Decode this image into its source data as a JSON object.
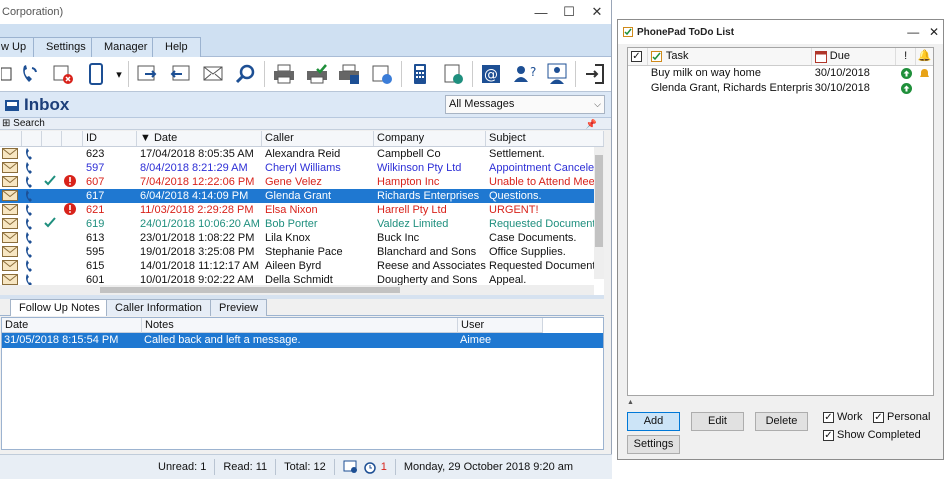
{
  "main_window": {
    "title": "Corporation)",
    "menu_tabs": [
      "w Up",
      "Settings",
      "Manager",
      "Help"
    ],
    "inbox_title": "Inbox",
    "filter_value": "All Messages",
    "search_label": "Search",
    "columns": [
      "ID",
      "Date",
      "Caller",
      "Company",
      "Subject"
    ],
    "messages": [
      {
        "id": "623",
        "date": "17/04/2018 8:05:35 AM",
        "caller": "Alexandra Reid",
        "company": "Campbell Co",
        "subject": "Settlement.",
        "style": "normal",
        "done": false,
        "urgent": false
      },
      {
        "id": "597",
        "date": "8/04/2018 8:21:29 AM",
        "caller": "Cheryl Williams",
        "company": "Wilkinson Pty Ltd",
        "subject": "Appointment Cancele",
        "style": "blue",
        "done": false,
        "urgent": false
      },
      {
        "id": "607",
        "date": "7/04/2018 12:22:06 PM",
        "caller": "Gene Velez",
        "company": "Hampton Inc",
        "subject": "Unable to Attend Mee",
        "style": "red",
        "done": true,
        "urgent": true
      },
      {
        "id": "617",
        "date": "6/04/2018 4:14:09 PM",
        "caller": "Glenda Grant",
        "company": "Richards Enterprises",
        "subject": "Questions.",
        "style": "selected",
        "done": false,
        "urgent": false
      },
      {
        "id": "621",
        "date": "11/03/2018 2:29:28 PM",
        "caller": "Elsa Nixon",
        "company": "Harrell Pty Ltd",
        "subject": "URGENT!",
        "style": "red",
        "done": false,
        "urgent": true
      },
      {
        "id": "619",
        "date": "24/01/2018 10:06:20 AM",
        "caller": "Bob Porter",
        "company": "Valdez Limited",
        "subject": "Requested Document",
        "style": "teal",
        "done": true,
        "urgent": false
      },
      {
        "id": "613",
        "date": "23/01/2018 1:08:22 PM",
        "caller": "Lila Knox",
        "company": "Buck Inc",
        "subject": "Case Documents.",
        "style": "normal",
        "done": false,
        "urgent": false
      },
      {
        "id": "595",
        "date": "19/01/2018 3:25:08 PM",
        "caller": "Stephanie Pace",
        "company": "Blanchard and Sons",
        "subject": "Office Supplies.",
        "style": "normal",
        "done": false,
        "urgent": false
      },
      {
        "id": "615",
        "date": "14/01/2018 11:12:17 AM",
        "caller": "Aileen Byrd",
        "company": "Reese and Associates",
        "subject": "Requested Document",
        "style": "normal",
        "done": false,
        "urgent": false
      },
      {
        "id": "601",
        "date": "10/01/2018 9:02:22 AM",
        "caller": "Della Schmidt",
        "company": "Dougherty and Sons",
        "subject": "Appeal.",
        "style": "normal",
        "done": false,
        "urgent": false
      }
    ],
    "bottom_tabs": [
      "Follow Up Notes",
      "Caller Information",
      "Preview"
    ],
    "notes_columns": [
      "Date",
      "Notes",
      "User"
    ],
    "notes": [
      {
        "date": "31/05/2018 8:15:54 PM",
        "note": "Called back and left a message.",
        "user": "Aimee"
      }
    ],
    "status": {
      "unread": "Unread: 1",
      "read": "Read: 11",
      "total": "Total: 12",
      "alarm_count": "1",
      "datetime": "Monday, 29 October 2018  9:20 am"
    }
  },
  "todo_window": {
    "title": "PhonePad ToDo List",
    "columns": {
      "task": "Task",
      "due": "Due",
      "priority": "!"
    },
    "items": [
      {
        "task": "Buy milk on way home",
        "due": "30/10/2018",
        "priority": "high",
        "reminder": true
      },
      {
        "task": "Glenda Grant, Richards Enterprise...",
        "due": "30/10/2018",
        "priority": "high",
        "reminder": false
      }
    ],
    "buttons": {
      "add": "Add",
      "edit": "Edit",
      "delete": "Delete",
      "settings": "Settings"
    },
    "filters": {
      "work": "Work",
      "personal": "Personal",
      "show_completed": "Show Completed"
    }
  },
  "colors": {
    "accent": "#1f78d1",
    "urgent": "#d8231b",
    "followup": "#2e2fd6",
    "done": "#1f8f7e"
  }
}
